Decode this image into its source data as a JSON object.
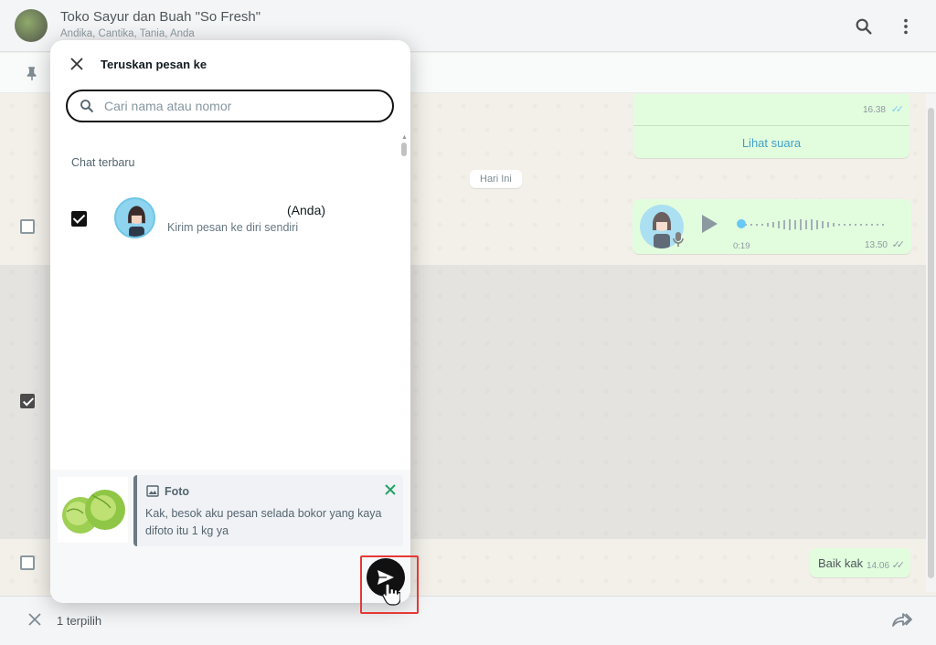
{
  "header": {
    "group_title": "Toko Sayur dan Buah \"So Fresh\"",
    "members": "Andika, Cantika, Tania, Anda"
  },
  "chat": {
    "message1_time": "16.38",
    "message1_link": "Lihat suara",
    "date_chip": "Hari Ini",
    "voice_duration": "0:19",
    "voice_time": "13.50",
    "reply_text": "Baik kak",
    "reply_time": "14.06"
  },
  "modal": {
    "title": "Teruskan pesan ke",
    "search_placeholder": "Cari nama atau nomor",
    "section_label": "Chat terbaru",
    "contact_name": "(Anda)",
    "contact_subtitle": "Kirim pesan ke diri sendiri",
    "contact_checked": true,
    "quote_type": "Foto",
    "quote_text": "Kak, besok aku pesan selada bokor yang kaya difoto itu 1 kg ya"
  },
  "footer": {
    "selected_count": "1 terpilih"
  },
  "colors": {
    "header_bg": "#f0f2f5",
    "bubble_out": "#d9fdd3",
    "accent_green": "#25d366",
    "highlight": "#e53935"
  }
}
